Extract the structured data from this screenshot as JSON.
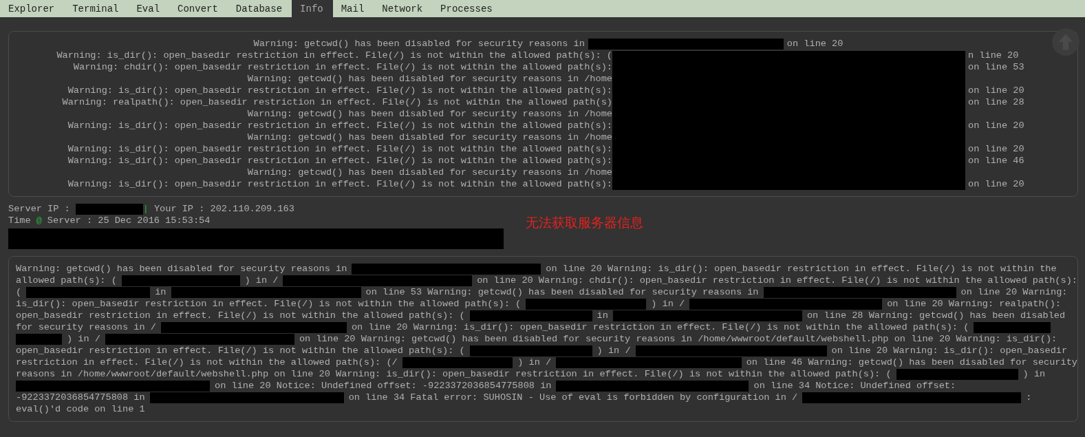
{
  "tabs": [
    {
      "label": "Explorer",
      "selected": false
    },
    {
      "label": "Terminal",
      "selected": false
    },
    {
      "label": "Eval",
      "selected": false
    },
    {
      "label": "Convert",
      "selected": false
    },
    {
      "label": "Database",
      "selected": false
    },
    {
      "label": "Info",
      "selected": true
    },
    {
      "label": "Mail",
      "selected": false
    },
    {
      "label": "Network",
      "selected": false
    },
    {
      "label": "Processes",
      "selected": false
    }
  ],
  "warnings_panel": {
    "first_line": [
      {
        "kind": "text",
        "text": "Warning: getcwd() has been disabled for security reasons in"
      },
      {
        "kind": "redaction"
      },
      {
        "kind": "text",
        "text": "on line 20"
      }
    ],
    "lines": [
      {
        "left": "Warning: is_dir(): open_basedir restriction in effect. File(/) is not within the allowed path(s): (",
        "right": "n line 20"
      },
      {
        "left": "Warning: chdir(): open_basedir restriction in effect. File(/) is not within the allowed path(s):",
        "right": "on line 53"
      },
      {
        "left": "Warning: getcwd() has been disabled for security reasons in /home"
      },
      {
        "left": "Warning: is_dir(): open_basedir restriction in effect. File(/) is not within the allowed path(s):",
        "right": "on line 20"
      },
      {
        "left": "Warning: realpath(): open_basedir restriction in effect. File(/) is not within the allowed path(s)",
        "right": "on line 28"
      },
      {
        "left": "Warning: getcwd() has been disabled for security reasons in /home"
      },
      {
        "left": "Warning: is_dir(): open_basedir restriction in effect. File(/) is not within the allowed path(s):",
        "right": "on line 20"
      },
      {
        "left": "Warning: getcwd() has been disabled for security reasons in /home"
      },
      {
        "left": "Warning: is_dir(): open_basedir restriction in effect. File(/) is not within the allowed path(s):",
        "right": "on line 20"
      },
      {
        "left": "Warning: is_dir(): open_basedir restriction in effect. File(/) is not within the allowed path(s):",
        "right": "on line 46"
      },
      {
        "left": "Warning: getcwd() has been disabled for security reasons in /home"
      },
      {
        "left": "Warning: is_dir(): open_basedir restriction in effect. File(/) is not within the allowed path(s):",
        "right": "on line 20"
      }
    ]
  },
  "server_info": {
    "server_ip_label": "Server IP :",
    "separator": "|",
    "your_ip": "Your IP : 202.110.209.163",
    "time_label": "Time",
    "at": "@",
    "time_value": "Server : 25 Dec 2016 15:53:54",
    "notice": "无法获取服务器信息"
  },
  "eval_output": {
    "lines": [
      [
        {
          "kind": "text",
          "text": "Warning: getcwd() has been disabled for security reasons in"
        },
        {
          "kind": "redaction"
        },
        {
          "kind": "text",
          "text": "on line 20 Warning: is_dir(): open_basedir restriction in effect. File(/) is not within the"
        }
      ],
      [
        {
          "kind": "text",
          "text": "allowed path(s): ("
        },
        {
          "kind": "redaction"
        },
        {
          "kind": "text",
          "text": ") in /"
        },
        {
          "kind": "redaction"
        },
        {
          "kind": "text",
          "text": "on line 20 Warning: chdir(): open_basedir restriction in effect. File(/) is not within the allowed path(s):"
        }
      ],
      [
        {
          "kind": "text",
          "text": "("
        },
        {
          "kind": "redaction"
        },
        {
          "kind": "text",
          "text": "in"
        },
        {
          "kind": "redaction"
        },
        {
          "kind": "text",
          "text": "on line 53 Warning: getcwd() has been disabled for security reasons in"
        },
        {
          "kind": "redaction"
        },
        {
          "kind": "text",
          "text": "on line 20 Warning:"
        }
      ],
      [
        {
          "kind": "text",
          "text": "is_dir(): open_basedir restriction in effect. File(/) is not within the allowed path(s): ("
        },
        {
          "kind": "redaction"
        },
        {
          "kind": "text",
          "text": ") in /"
        },
        {
          "kind": "redaction"
        },
        {
          "kind": "text",
          "text": "on line 20 Warning: realpath():"
        }
      ],
      [
        {
          "kind": "text",
          "text": "open_basedir restriction in effect. File(/) is not within the allowed path(s): ("
        },
        {
          "kind": "redaction"
        },
        {
          "kind": "text",
          "text": "in"
        },
        {
          "kind": "redaction"
        },
        {
          "kind": "text",
          "text": "on line 28 Warning: getcwd() has been disabled"
        }
      ],
      [
        {
          "kind": "text",
          "text": "for security reasons in /"
        },
        {
          "kind": "redaction"
        },
        {
          "kind": "text",
          "text": "on line 20 Warning: is_dir(): open_basedir restriction in effect. File(/) is not within the allowed path(s): ("
        },
        {
          "kind": "redaction"
        }
      ],
      [
        {
          "kind": "redaction"
        },
        {
          "kind": "text",
          "text": ") in /"
        },
        {
          "kind": "redaction"
        },
        {
          "kind": "text",
          "text": "on line 20 Warning: getcwd() has been disabled for security reasons in /home/wwwroot/default/webshell.php on line 20 Warning: is_dir():"
        }
      ],
      [
        {
          "kind": "text",
          "text": "open_basedir restriction in effect. File(/) is not within the allowed path(s): ("
        },
        {
          "kind": "redaction"
        },
        {
          "kind": "text",
          "text": ") in /"
        },
        {
          "kind": "redaction"
        },
        {
          "kind": "text",
          "text": "on line 20 Warning: is_dir(): open_basedir"
        }
      ],
      [
        {
          "kind": "text",
          "text": "restriction in effect. File(/) is not within the allowed path(s): (/"
        },
        {
          "kind": "redaction"
        },
        {
          "kind": "text",
          "text": ") in /"
        },
        {
          "kind": "redaction"
        },
        {
          "kind": "text",
          "text": "on line 46 Warning: getcwd() has been disabled for security"
        }
      ],
      [
        {
          "kind": "text",
          "text": "reasons in /home/wwwroot/default/webshell.php on line 20 Warning: is_dir(): open_basedir restriction in effect. File(/) is not within the allowed path(s): ("
        },
        {
          "kind": "redaction"
        },
        {
          "kind": "text",
          "text": ") in"
        }
      ],
      [
        {
          "kind": "redaction"
        },
        {
          "kind": "text",
          "text": "on line 20 Notice: Undefined offset: -9223372036854775808 in"
        },
        {
          "kind": "redaction"
        },
        {
          "kind": "text",
          "text": "on line 34 Notice: Undefined offset:"
        }
      ],
      [
        {
          "kind": "text",
          "text": "-9223372036854775808 in"
        },
        {
          "kind": "redaction"
        },
        {
          "kind": "text",
          "text": "on line 34 Fatal error: SUHOSIN - Use of eval is forbidden by configuration in /"
        },
        {
          "kind": "redaction"
        },
        {
          "kind": "text",
          "text": ":"
        }
      ],
      [
        {
          "kind": "text",
          "text": "eval()'d code on line 1"
        }
      ]
    ]
  }
}
